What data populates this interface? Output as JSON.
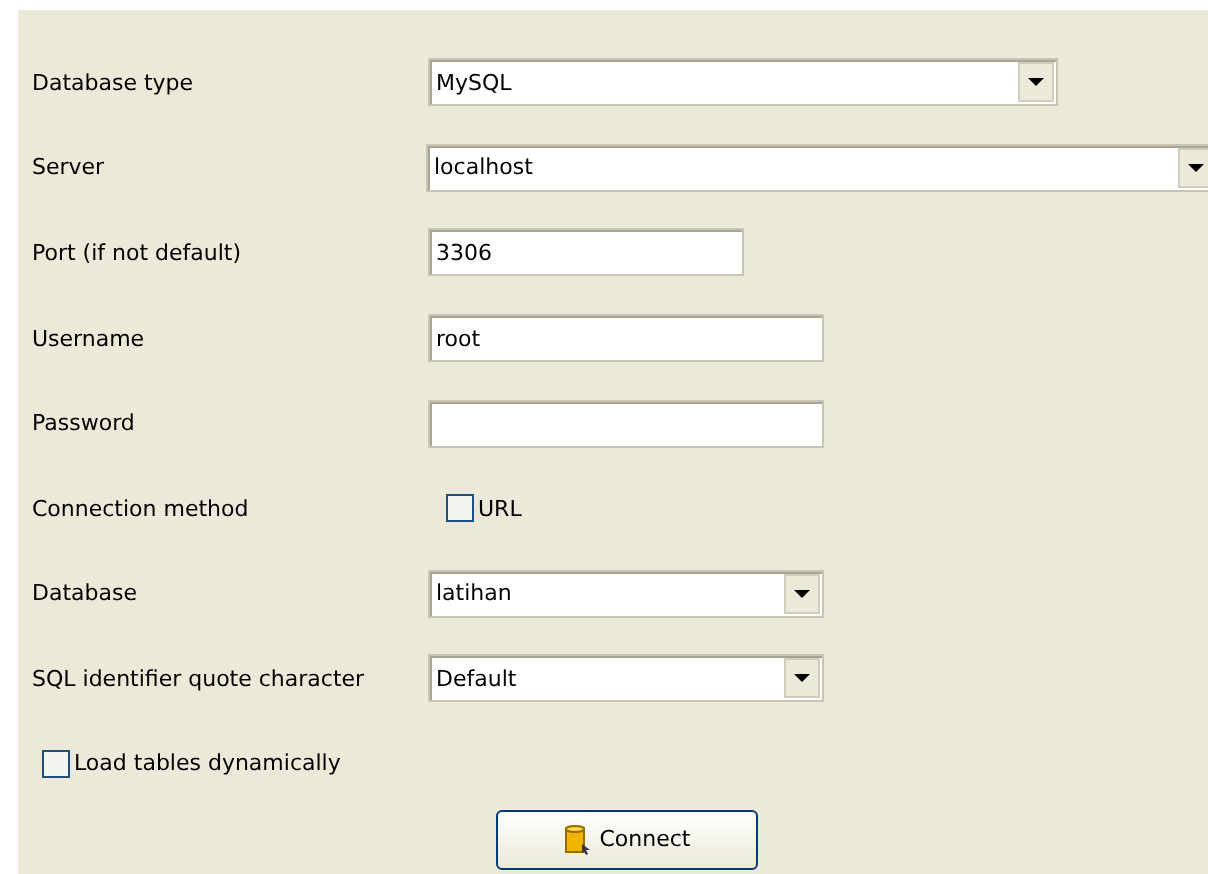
{
  "fields": [
    {
      "label": "Database type",
      "kind": "select",
      "value": "MySQL"
    },
    {
      "label": "Server",
      "kind": "select",
      "value": "localhost"
    },
    {
      "label": "Port (if not default)",
      "kind": "text",
      "value": "3306"
    },
    {
      "label": "Username",
      "kind": "text",
      "value": "root"
    },
    {
      "label": "Password",
      "kind": "password"
    },
    {
      "label": "Connection method",
      "kind": "checkbox",
      "option": "URL",
      "checked": false
    },
    {
      "label": "Database",
      "kind": "select",
      "value": "latihan"
    },
    {
      "label": "SQL identifier quote character",
      "kind": "select",
      "value": "Default"
    }
  ],
  "load_tables": {
    "label": "Load tables dynamically",
    "checked": false
  },
  "connect_button": "Connect"
}
